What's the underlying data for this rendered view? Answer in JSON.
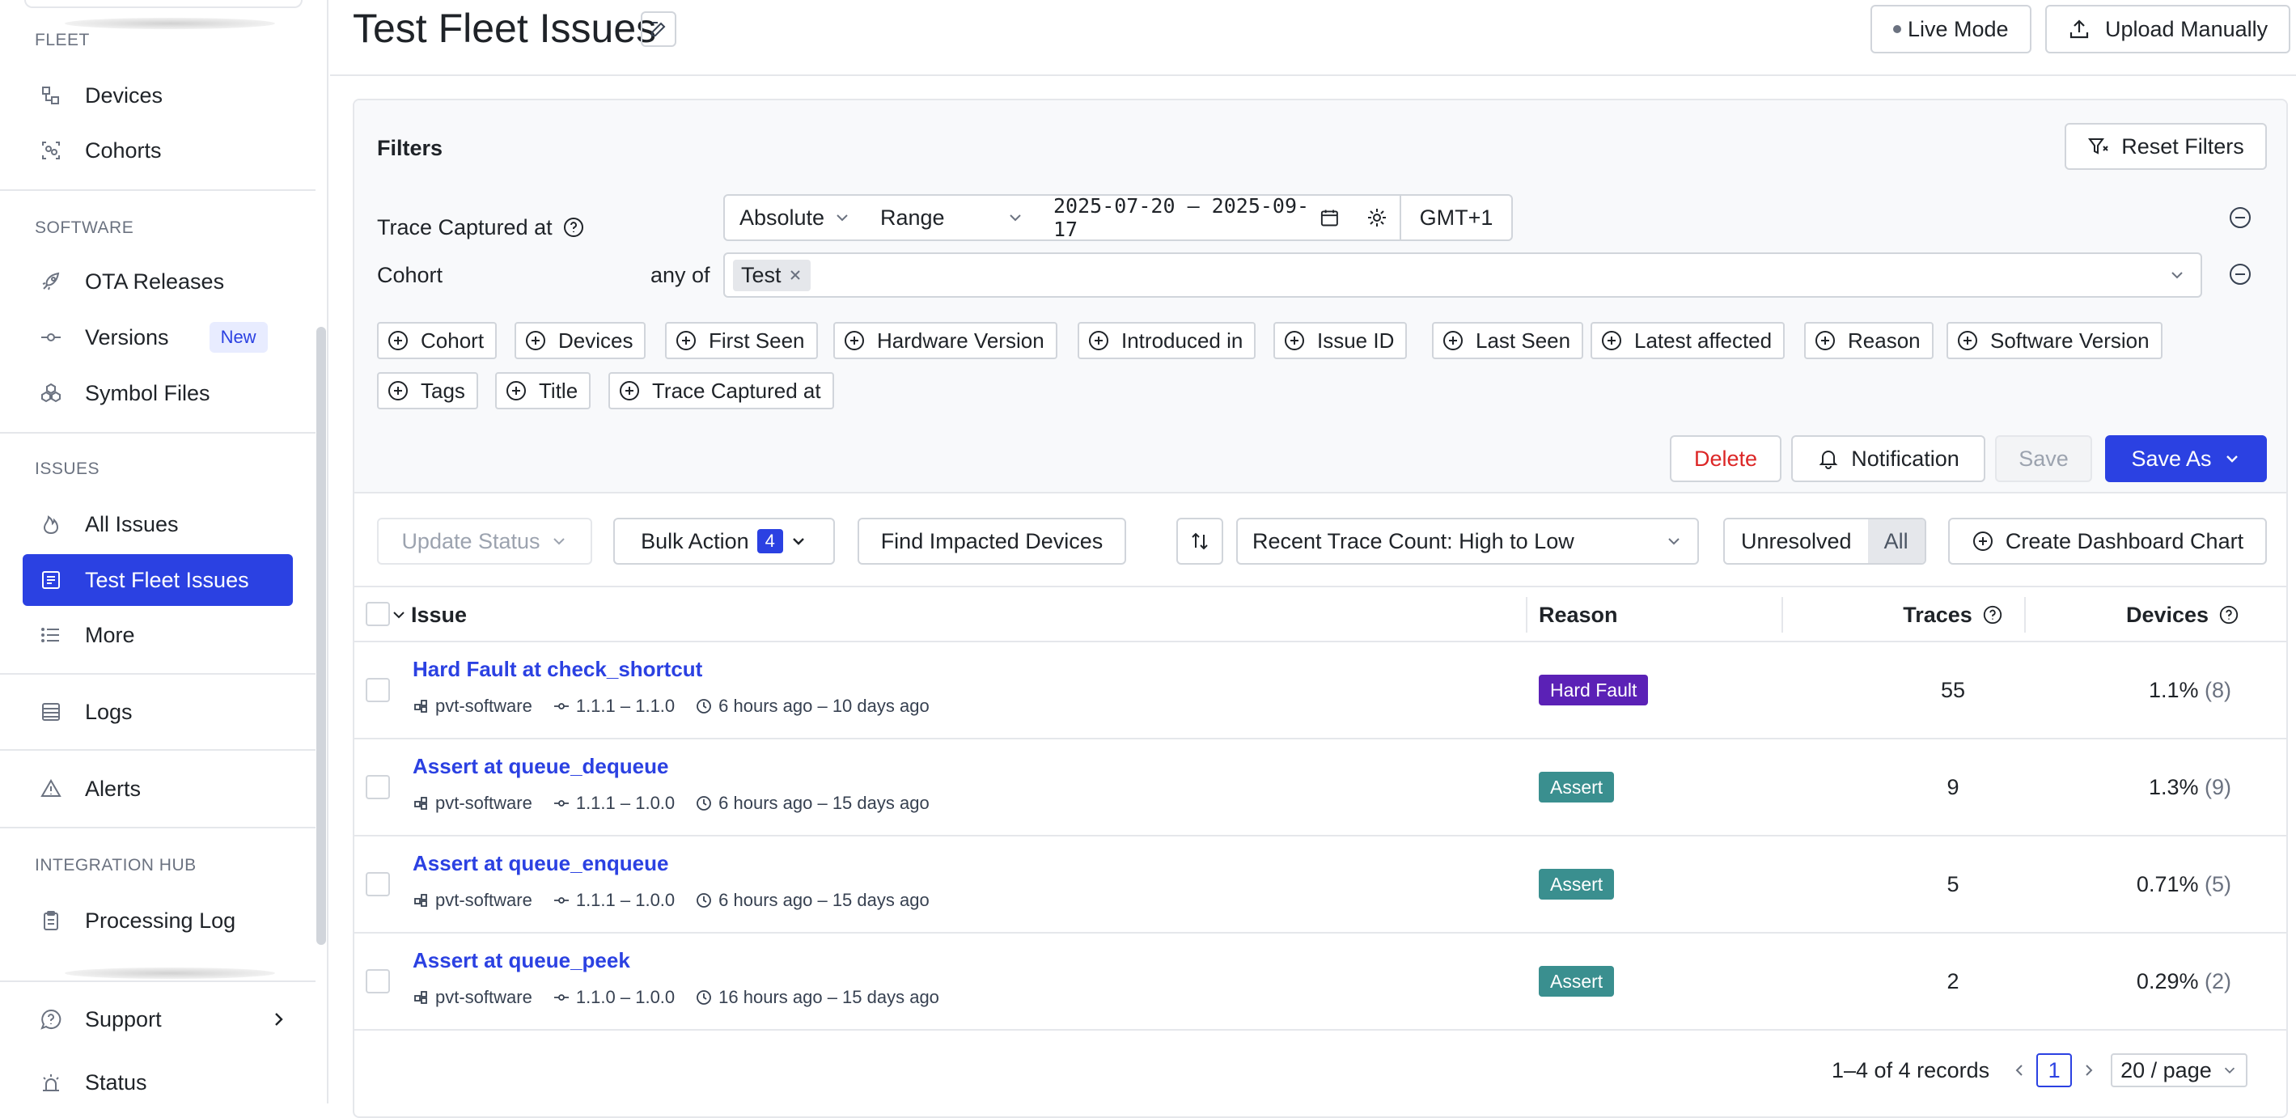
{
  "sidebar": {
    "sections": {
      "fleet": "FLEET",
      "software": "SOFTWARE",
      "issues": "ISSUES",
      "integration": "INTEGRATION HUB"
    },
    "items": {
      "devices": "Devices",
      "cohorts": "Cohorts",
      "ota": "OTA Releases",
      "versions": "Versions",
      "versions_badge": "New",
      "symbols": "Symbol Files",
      "all_issues": "All Issues",
      "test_fleet": "Test Fleet Issues",
      "more": "More",
      "logs": "Logs",
      "alerts": "Alerts",
      "processing": "Processing Log",
      "support": "Support",
      "status": "Status"
    }
  },
  "header": {
    "title": "Test Fleet Issues",
    "live_mode": "Live Mode",
    "upload": "Upload Manually"
  },
  "filters": {
    "title": "Filters",
    "reset": "Reset Filters",
    "trace_label": "Trace Captured at",
    "mode": "Absolute",
    "range": "Range",
    "date_range": "2025-07-20 – 2025-09-17",
    "timezone": "GMT+1",
    "cohort_label": "Cohort",
    "cohort_op": "any of",
    "cohort_value": "Test",
    "chips": [
      "Cohort",
      "Devices",
      "First Seen",
      "Hardware Version",
      "Introduced in",
      "Issue ID",
      "Last Seen",
      "Latest affected",
      "Reason",
      "Software Version",
      "Tags",
      "Title",
      "Trace Captured at"
    ],
    "delete": "Delete",
    "notification": "Notification",
    "save": "Save",
    "save_as": "Save As"
  },
  "toolbar": {
    "update_status": "Update Status",
    "bulk_action": "Bulk Action",
    "bulk_count": "4",
    "find_impacted": "Find Impacted Devices",
    "sort": "Recent Trace Count: High to Low",
    "unresolved": "Unresolved",
    "all": "All",
    "create_chart": "Create Dashboard Chart"
  },
  "table": {
    "headers": {
      "issue": "Issue",
      "reason": "Reason",
      "traces": "Traces",
      "devices": "Devices"
    },
    "rows": [
      {
        "title": "Hard Fault at check_shortcut",
        "project": "pvt-software",
        "versions": "1.1.1 – 1.1.0",
        "time": "6 hours ago – 10 days ago",
        "reason": "Hard Fault",
        "reason_color": "#5b21b6",
        "traces": "55",
        "pct": "1.1%",
        "count": "(8)"
      },
      {
        "title": "Assert at queue_dequeue",
        "project": "pvt-software",
        "versions": "1.1.1 – 1.0.0",
        "time": "6 hours ago – 15 days ago",
        "reason": "Assert",
        "reason_color": "#3a8f8f",
        "traces": "9",
        "pct": "1.3%",
        "count": "(9)"
      },
      {
        "title": "Assert at queue_enqueue",
        "project": "pvt-software",
        "versions": "1.1.1 – 1.0.0",
        "time": "6 hours ago – 15 days ago",
        "reason": "Assert",
        "reason_color": "#3a8f8f",
        "traces": "5",
        "pct": "0.71%",
        "count": "(5)"
      },
      {
        "title": "Assert at queue_peek",
        "project": "pvt-software",
        "versions": "1.1.0 – 1.0.0",
        "time": "16 hours ago – 15 days ago",
        "reason": "Assert",
        "reason_color": "#3a8f8f",
        "traces": "2",
        "pct": "0.29%",
        "count": "(2)"
      }
    ]
  },
  "pagination": {
    "summary": "1–4 of 4 records",
    "current": "1",
    "per_page": "20 / page"
  }
}
